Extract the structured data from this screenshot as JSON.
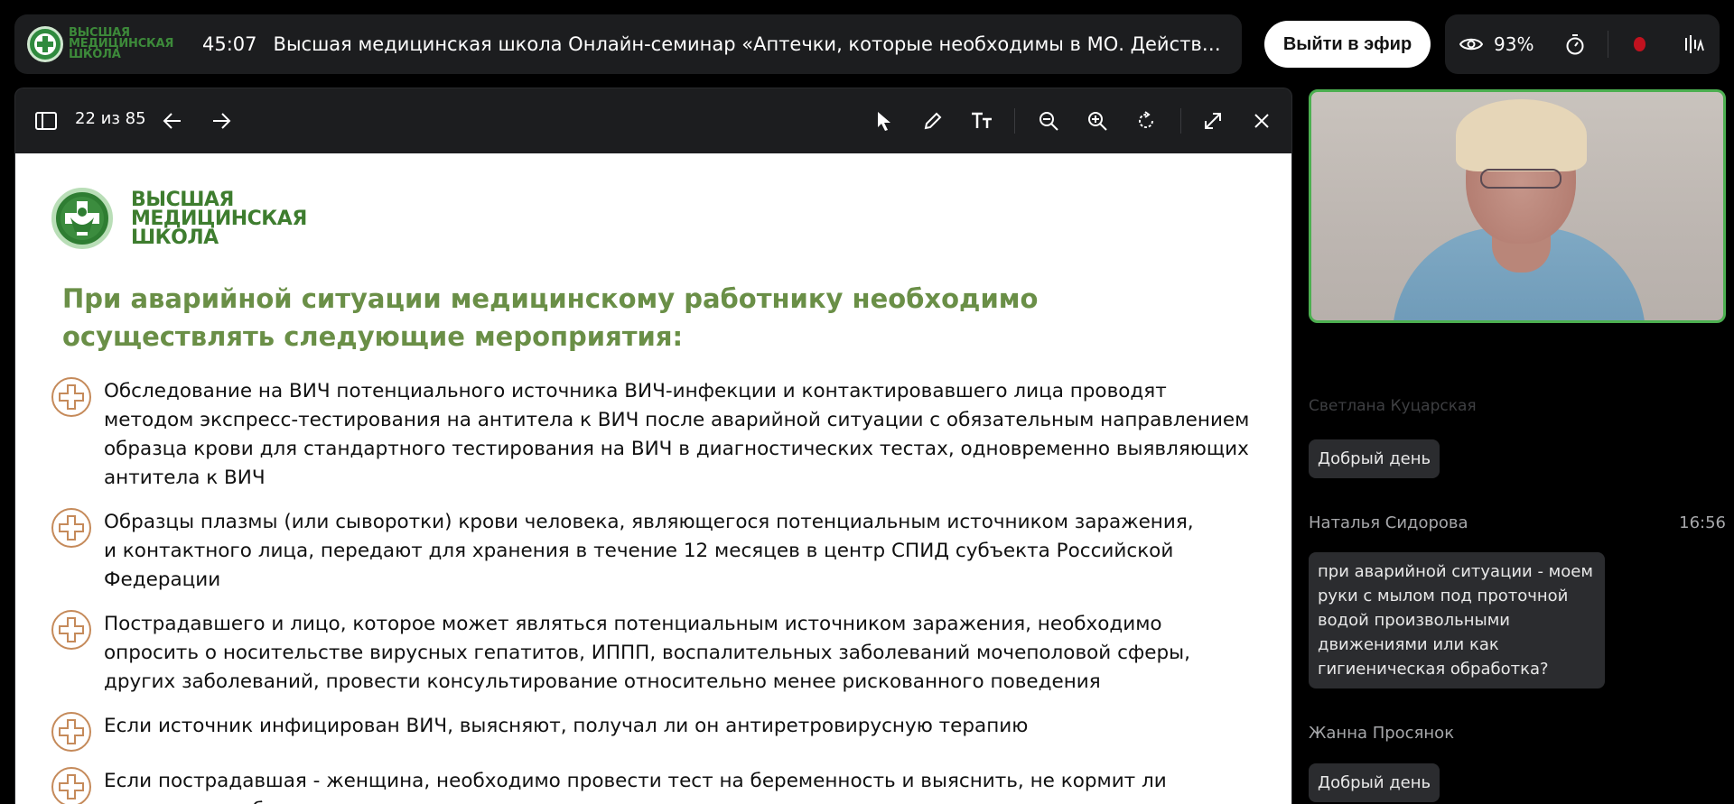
{
  "topbar": {
    "logo_text_line1": "ВЫСШАЯ",
    "logo_text_line2": "МЕДИЦИНСКАЯ",
    "logo_text_line3": "ШКОЛА",
    "timer": "45:07",
    "webinar_title": "Высшая медицинская школа  Онлайн-семинар «Аптечки, которые необходимы в МО. Действия медперсон..."
  },
  "golive_label": "Выйти в эфир",
  "status": {
    "viewers_percent": "93%",
    "icons": [
      "eye-icon",
      "timer-icon",
      "record-indicator",
      "audio-settings-icon"
    ],
    "record_color": "#c1121f"
  },
  "viewer": {
    "page_counter": "22 из 85",
    "tools": [
      "sidebar-toggle-icon",
      "arrow-left-icon",
      "arrow-right-icon",
      "pointer-icon",
      "pencil-icon",
      "text-size-icon",
      "zoom-out-icon",
      "zoom-in-icon",
      "rotate-icon",
      "fullscreen-icon",
      "close-icon"
    ]
  },
  "slide": {
    "logo_line1": "ВЫСШАЯ",
    "logo_line2": "МЕДИЦИНСКАЯ",
    "logo_line3": "ШКОЛА",
    "heading": "При аварийной ситуации медицинскому работнику необходимо осуществлять следующие мероприятия:",
    "heading_color": "#6a8f47",
    "items": [
      "Обследование на ВИЧ потенциального источника ВИЧ-инфекции и контактировавшего лица проводят\nметодом экспресс-тестирования на антитела к ВИЧ после аварийной ситуации с обязательным направлением\nобразца крови для стандартного тестирования на ВИЧ в диагностических тестах, одновременно выявляющих\nантитела к ВИЧ",
      "Образцы плазмы (или сыворотки) крови человека, являющегося потенциальным источником заражения,\nи контактного лица, передают для хранения в течение 12 месяцев в центр СПИД субъекта Российской Федерации",
      "Пострадавшего и лицо, которое может являться потенциальным источником заражения, необходимо\nопросить о носительстве вирусных гепатитов, ИППП, воспалительных заболеваний мочеполовой сферы,\nдругих заболеваний, провести консультирование относительно менее рискованного поведения",
      "Если источник инфицирован ВИЧ, выясняют, получал ли он антиретровирусную терапию",
      "Если пострадавшая - женщина, необходимо провести тест на беременность и выяснить, не кормит ли\nона грудью ребенка"
    ]
  },
  "chat": {
    "faded_author": "Светлана Куцарская",
    "messages": [
      {
        "text": "Добрый день"
      },
      {
        "author": "Наталья Сидорова",
        "time": "16:56",
        "text": "при аварийной ситуации - моем руки с мылом под проточной водой произвольными движениями или как гигиеническая обработка?"
      },
      {
        "author": "Жанна Просянок",
        "text": "Добрый день"
      }
    ]
  }
}
